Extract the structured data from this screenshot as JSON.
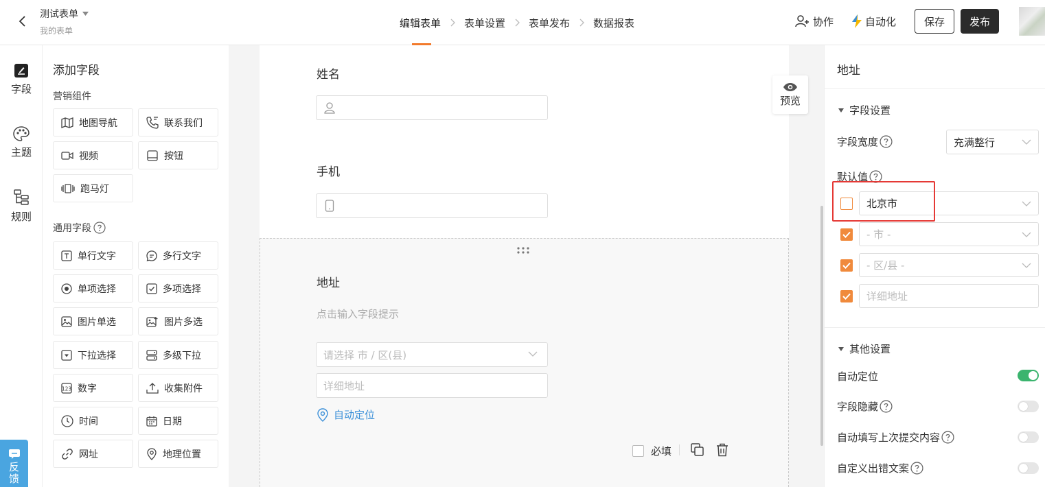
{
  "header": {
    "form_title": "测试表单",
    "form_subtitle": "我的表单",
    "steps": [
      "编辑表单",
      "表单设置",
      "表单发布",
      "数据报表"
    ],
    "collab_label": "协作",
    "automation_label": "自动化",
    "save_label": "保存",
    "publish_label": "发布"
  },
  "rail": {
    "items": [
      "字段",
      "主题",
      "规则"
    ],
    "feedback_label": "反馈"
  },
  "field_panel": {
    "title": "添加字段",
    "marketing_title": "营销组件",
    "marketing_items": [
      "地图导航",
      "联系我们",
      "视频",
      "按钮",
      "跑马灯"
    ],
    "general_title": "通用字段",
    "general_items": [
      "单行文字",
      "多行文字",
      "单项选择",
      "多项选择",
      "图片单选",
      "图片多选",
      "下拉选择",
      "多级下拉",
      "数字",
      "收集附件",
      "时间",
      "日期",
      "网址",
      "地理位置"
    ]
  },
  "canvas": {
    "name_label": "姓名",
    "phone_label": "手机",
    "address_label": "地址",
    "address_hint": "点击输入字段提示",
    "address_select_placeholder": "请选择 市 / 区(县)",
    "address_detail_placeholder": "详细地址",
    "auto_locate_label": "自动定位",
    "required_label": "必填",
    "preview_label": "预览"
  },
  "props": {
    "title": "地址",
    "field_settings_title": "字段设置",
    "field_width_label": "字段宽度",
    "field_width_value": "充满整行",
    "default_value_label": "默认值",
    "default_rows": [
      {
        "checked": false,
        "value": "北京市",
        "placeholder": ""
      },
      {
        "checked": true,
        "value": "",
        "placeholder": "- 市 -"
      },
      {
        "checked": true,
        "value": "",
        "placeholder": "- 区/县 -"
      },
      {
        "checked": true,
        "value": "",
        "placeholder": "详细地址"
      }
    ],
    "other_settings_title": "其他设置",
    "toggles": [
      {
        "label": "自动定位",
        "on": true
      },
      {
        "label": "字段隐藏",
        "on": false
      },
      {
        "label": "自动填写上次提交内容",
        "on": false
      },
      {
        "label": "自定义出错文案",
        "on": false
      }
    ]
  },
  "colors": {
    "accent_orange": "#f08a3c",
    "tab_underline": "#f27a2c",
    "toggle_on": "#3bb46e",
    "link_blue": "#3a8fd8",
    "feedback_blue": "#4aa5e0",
    "highlight_red": "#e53935"
  }
}
